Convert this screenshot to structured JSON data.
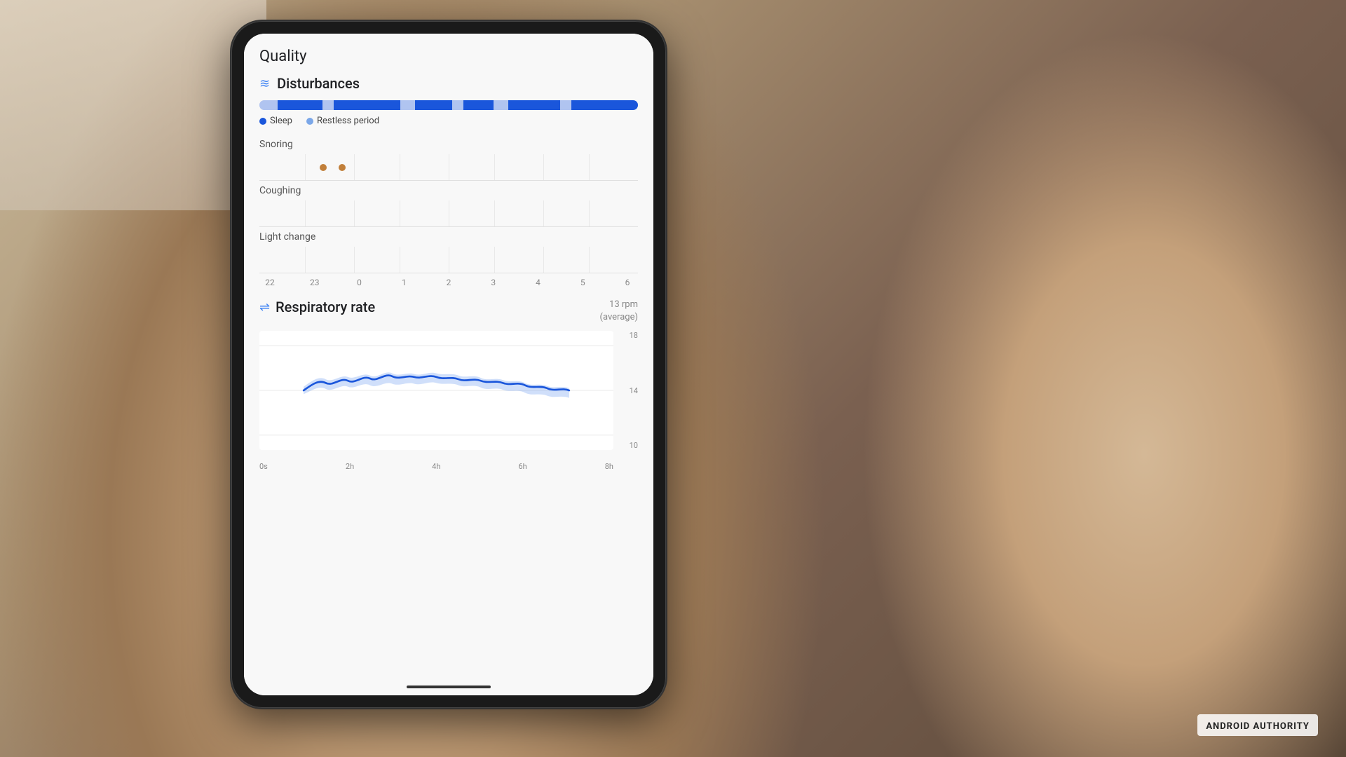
{
  "screen": {
    "quality_label": "Quality",
    "disturbances": {
      "title": "Disturbances",
      "legend": {
        "sleep_label": "Sleep",
        "restless_label": "Restless period"
      },
      "timeline_segments": [
        {
          "color": "#b0c4f0",
          "flex": 0.05
        },
        {
          "color": "#1a56db",
          "flex": 0.12
        },
        {
          "color": "#1a56db",
          "flex": 0.08
        },
        {
          "color": "#1a56db",
          "flex": 0.1
        },
        {
          "color": "#b0c4f0",
          "flex": 0.04
        },
        {
          "color": "#1a56db",
          "flex": 0.12
        },
        {
          "color": "#b0c4f0",
          "flex": 0.03
        },
        {
          "color": "#1a56db",
          "flex": 0.08
        },
        {
          "color": "#b0c4f0",
          "flex": 0.05
        },
        {
          "color": "#1a56db",
          "flex": 0.15
        },
        {
          "color": "#b0c4f0",
          "flex": 0.03
        },
        {
          "color": "#1a56db",
          "flex": 0.1
        },
        {
          "color": "#1a56db",
          "flex": 0.05
        }
      ],
      "snoring_label": "Snoring",
      "coughing_label": "Coughing",
      "light_change_label": "Light change",
      "time_labels": [
        "22",
        "23",
        "0",
        "1",
        "2",
        "3",
        "4",
        "5",
        "6"
      ]
    },
    "respiratory": {
      "title": "Respiratory rate",
      "average_label": "13 rpm",
      "average_sublabel": "(average)",
      "y_labels": [
        "18",
        "14",
        "10"
      ],
      "x_labels": [
        "0s",
        "2h",
        "4h",
        "6h",
        "8h"
      ],
      "chart_color": "#1a56db",
      "chart_area_color": "rgba(100, 149, 237, 0.25)"
    }
  },
  "watermark": {
    "line1": "ANDROID",
    "line2": "AUTHORITY",
    "full": "ANDROID AUTHORITY"
  }
}
